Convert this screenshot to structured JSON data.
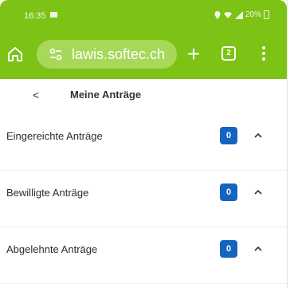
{
  "status_bar": {
    "time": "16:35",
    "right_text": "20%"
  },
  "browser": {
    "url": "lawis.softec.ch",
    "tab_count": "2",
    "theme_color": "#7cc316"
  },
  "header": {
    "back_glyph": "<",
    "title": "Meine Anträge"
  },
  "sections": [
    {
      "label": "Eingereichte Anträge",
      "count": "0"
    },
    {
      "label": "Bewilligte Anträge",
      "count": "0"
    },
    {
      "label": "Abgelehnte Anträge",
      "count": "0"
    }
  ],
  "colors": {
    "badge": "#1565c0"
  },
  "icons": [
    "home-icon",
    "site-settings-icon",
    "plus-icon",
    "tabs-icon",
    "menu-icon",
    "chevron-up-icon",
    "wifi-icon",
    "signal-icon",
    "battery-icon",
    "message-icon"
  ]
}
